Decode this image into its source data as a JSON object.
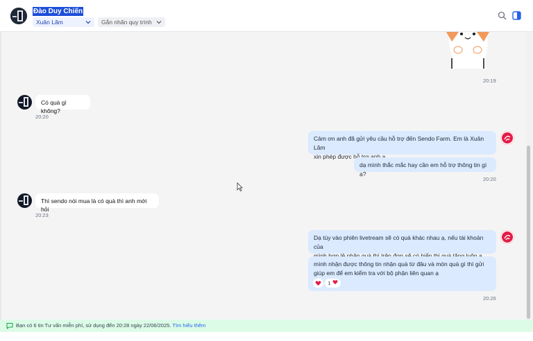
{
  "header": {
    "contact_name": "Đào Duy Chiến",
    "agent_select": "Xuân Lãm",
    "process_select": "Gắn nhãn quy trình",
    "icons": [
      "search-icon",
      "side-panel-icon",
      "chevron-down-icon"
    ]
  },
  "messages": {
    "sticker_time": "20:19",
    "q1": {
      "text": "Có quà gì không?",
      "time": "20:20"
    },
    "a1": {
      "line1": "Cảm ơn anh đã gửi yêu cầu hỗ trợ đến Sendo Farm. Em là Xuân Lãm",
      "line2": "xin phép được hỗ trợ anh ạ.",
      "followup": "dạ mình thắc mắc hay cần em hỗ trợ thông tin gì ạ?",
      "time": "20:20"
    },
    "q2": {
      "text": "Thì sendo nói mua là có quà thì anh mới hỏi",
      "time": "20:23"
    },
    "a2": {
      "line1": "Dạ tùy vào phiên livetream sẽ có quà khác nhau ạ, nếu tài khoản của",
      "line2": "mình hợp lệ nhận quà thì trên đơn sẽ có hiển thị quà tặng luôn ạ.",
      "followup_line1": "mình nhận được thông tin nhận quà từ đâu và món quà gì thì gửi",
      "followup_line2": "giúp em để em kiểm tra với bộ phận liên quan ạ",
      "reaction_count": "1",
      "time": "20:26"
    }
  },
  "footer": {
    "notice": "Bạn có 6 tin Tư vấn miễn phí, sử dụng đến 20:28 ngày 22/06/2025.",
    "link": "Tìm hiểu thêm"
  },
  "colors": {
    "accent": "#2563eb",
    "bubble_out": "#dbeafe",
    "footer_bg": "#dcfce7",
    "brand_red": "#e11d48"
  }
}
